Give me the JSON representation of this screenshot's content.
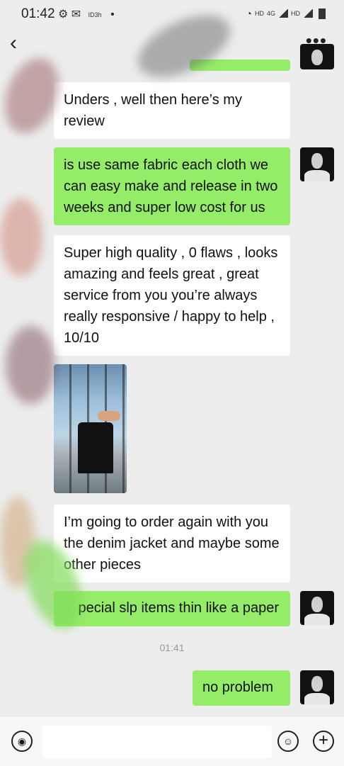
{
  "status_bar": {
    "time": "01:42",
    "left_small": "ID3h",
    "dot": "•",
    "hd1": "HD",
    "net": "4G",
    "hd2": "HD"
  },
  "header": {
    "back_icon": "chevron-left-icon",
    "more_icon": "more-dots-icon"
  },
  "messages": [
    {
      "side": "left",
      "text": "Unders      , well then here’s my review"
    },
    {
      "side": "right",
      "text": "is use same fabric each cloth we can easy make and release in two weeks and super low cost for us"
    },
    {
      "side": "left",
      "text": "Super high quality , 0 flaws , looks amazing and feels great , great service from you you’re always really responsive / happy to help , 10/10"
    },
    {
      "side": "left",
      "type": "image",
      "description": "photo"
    },
    {
      "side": "left",
      "text": "I’m going to order again with you the denim jacket and maybe some other pieces"
    },
    {
      "side": "right",
      "text": "pecial slp items thin like a paper"
    },
    {
      "side": "right",
      "text": "no problem"
    }
  ],
  "timestamp": "01:41",
  "input_bar": {
    "voice_icon": "voice-icon",
    "emoji_icon": "emoji-icon",
    "plus_icon": "plus-icon",
    "value": ""
  },
  "colors": {
    "background": "#ededed",
    "outgoing_bubble": "#95ec69",
    "incoming_bubble": "#ffffff"
  }
}
